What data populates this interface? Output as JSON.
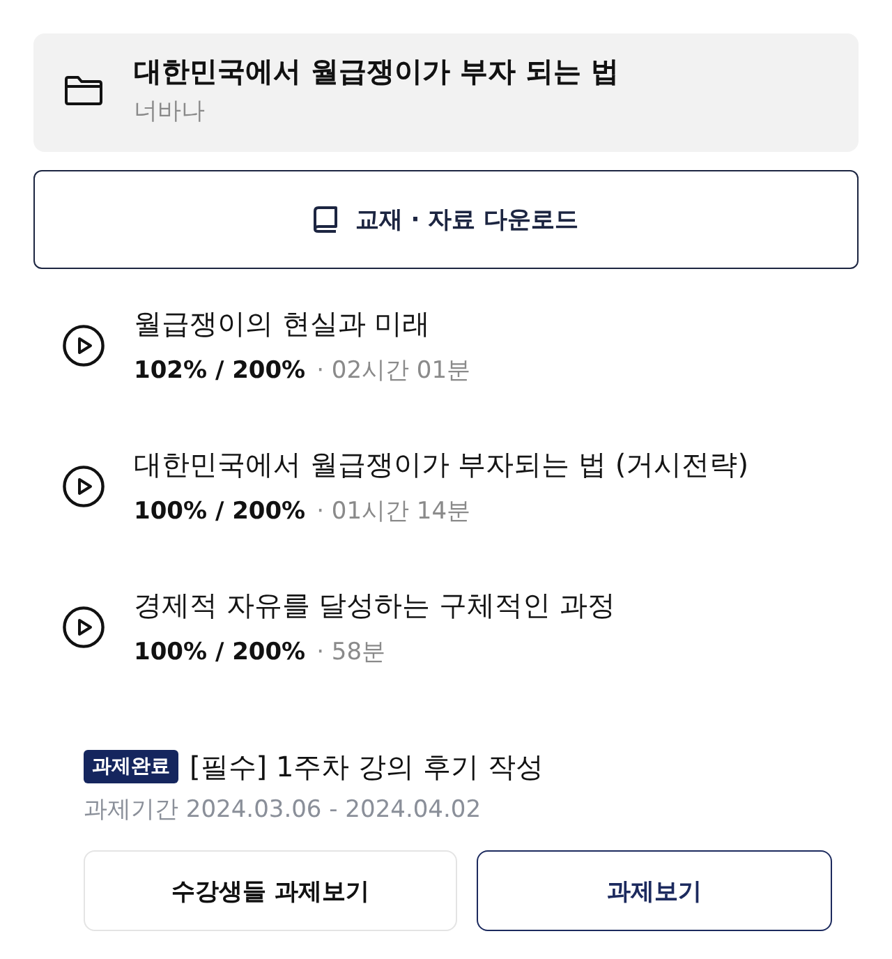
{
  "course": {
    "title": "대한민국에서 월급쟁이가 부자 되는 법",
    "instructor": "너바나"
  },
  "download_button": {
    "label": "교재 · 자료 다운로드"
  },
  "lectures": [
    {
      "title": "월급쟁이의 현실과 미래",
      "watch_rate": "102% / 200%",
      "duration": "· 02시간 01분"
    },
    {
      "title": "대한민국에서 월급쟁이가 부자되는 법 (거시전략)",
      "watch_rate": "100% / 200%",
      "duration": "· 01시간 14분"
    },
    {
      "title": "경제적 자유를 달성하는 구체적인 과정",
      "watch_rate": "100% / 200%",
      "duration": "· 58분"
    }
  ],
  "assignment": {
    "badge": "과제완료",
    "title": "[필수] 1주차 강의 후기 작성",
    "period": "과제기간 2024.03.06 - 2024.04.02"
  },
  "buttons": [
    {
      "label": "수강생들 과제보기",
      "kind": "secondary"
    },
    {
      "label": "과제보기",
      "kind": "primary"
    }
  ]
}
